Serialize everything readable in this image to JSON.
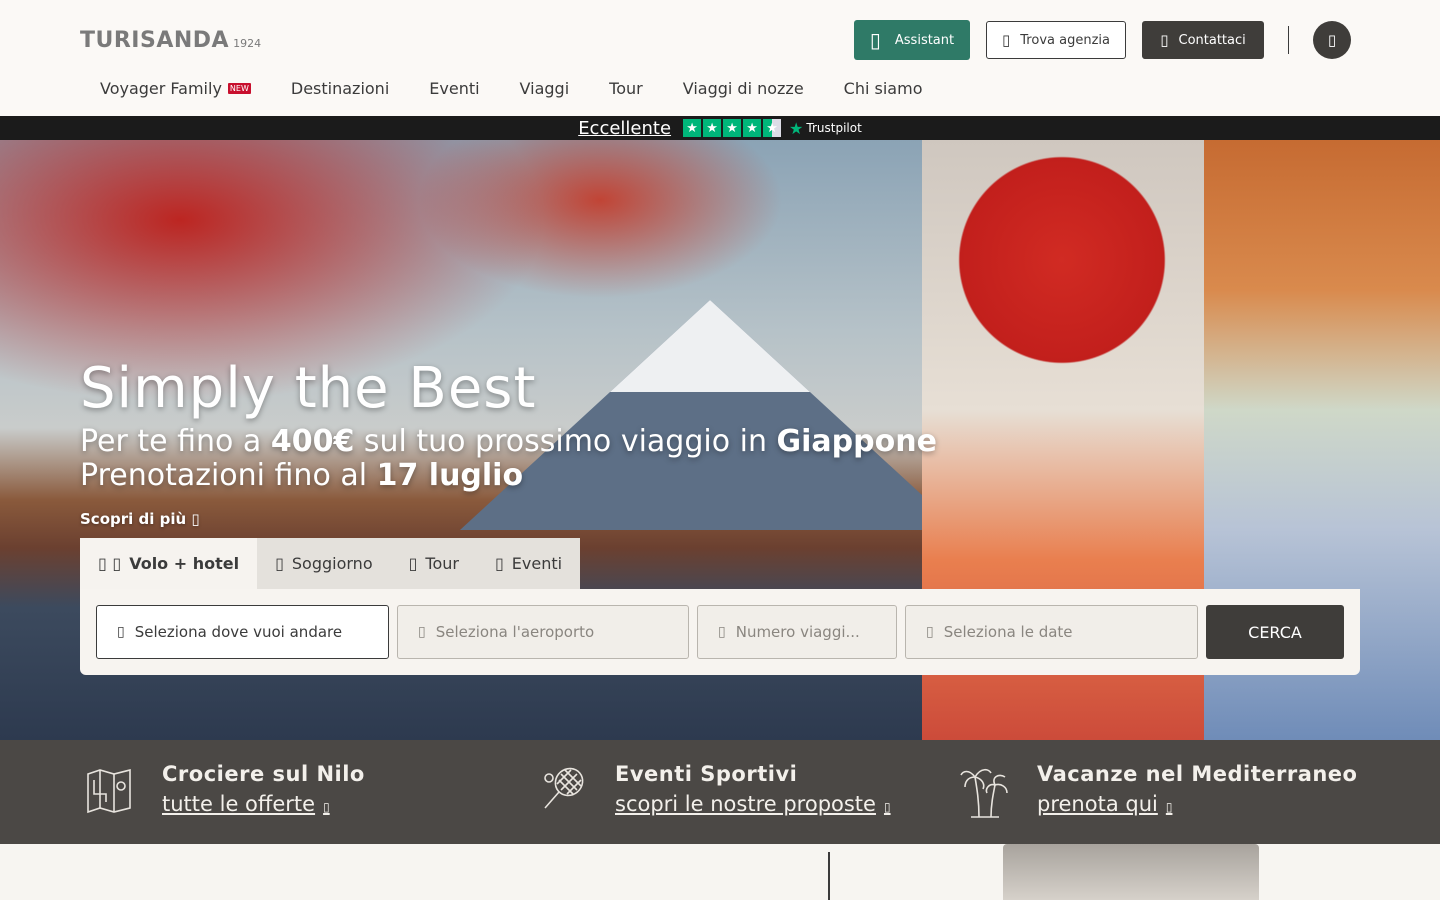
{
  "header": {
    "logo_word": "TURISANDA",
    "logo_year": "1924",
    "assistant_label": "Assistant",
    "agency_label": "Trova agenzia",
    "contact_label": "Contattaci"
  },
  "nav": {
    "items": [
      {
        "label": "Voyager Family",
        "badge": "NEW"
      },
      {
        "label": "Destinazioni"
      },
      {
        "label": "Eventi"
      },
      {
        "label": "Viaggi"
      },
      {
        "label": "Tour"
      },
      {
        "label": "Viaggi di nozze"
      },
      {
        "label": "Chi siamo"
      }
    ]
  },
  "trustpilot": {
    "rating_label": "Eccellente",
    "brand": "Trustpilot",
    "stars": 4.5,
    "accent": "#00b67a"
  },
  "hero": {
    "title": "Simply the Best",
    "line1_pre": "Per te fino a ",
    "line1_amount": "400€",
    "line1_mid": " sul tuo prossimo viaggio in ",
    "line1_dest": "Giappone",
    "line2_pre": "Prenotazioni fino al ",
    "line2_date": "17 luglio",
    "discover": "Scopri di più"
  },
  "search": {
    "tabs": [
      {
        "label": "Volo + hotel",
        "icon": "plane-hotel-icon",
        "active": true
      },
      {
        "label": "Soggiorno",
        "icon": "bed-icon"
      },
      {
        "label": "Tour",
        "icon": "map-icon"
      },
      {
        "label": "Eventi",
        "icon": "ticket-icon"
      }
    ],
    "destination_placeholder": "Seleziona dove vuoi andare",
    "airport_placeholder": "Seleziona l'aeroporto",
    "travelers_placeholder": "Numero viaggi...",
    "dates_placeholder": "Seleziona le date",
    "submit_label": "CERCA"
  },
  "promos": [
    {
      "title": "Crociere sul Nilo",
      "link": "tutte le offerte",
      "icon": "map-icon"
    },
    {
      "title": "Eventi Sportivi",
      "link": "scopri le nostre proposte",
      "icon": "tennis-racket-icon"
    },
    {
      "title": "Vacanze nel Mediterraneo",
      "link": "prenota qui",
      "icon": "palm-tree-icon"
    }
  ],
  "colors": {
    "brand_green": "#2f7a67",
    "dark": "#3f3d3a",
    "promo_band": "#4b4845",
    "new_badge": "#c8102e"
  }
}
